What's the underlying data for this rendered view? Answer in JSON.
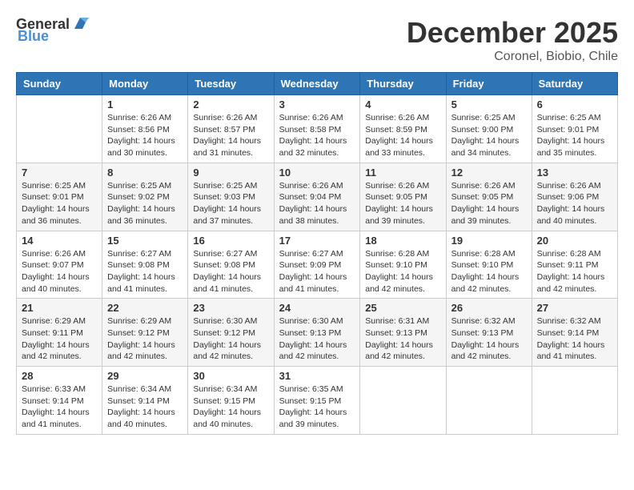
{
  "header": {
    "logo_general": "General",
    "logo_blue": "Blue",
    "month_year": "December 2025",
    "location": "Coronel, Biobio, Chile"
  },
  "weekdays": [
    "Sunday",
    "Monday",
    "Tuesday",
    "Wednesday",
    "Thursday",
    "Friday",
    "Saturday"
  ],
  "weeks": [
    [
      {
        "day": "",
        "sunrise": "",
        "sunset": "",
        "daylight": ""
      },
      {
        "day": "1",
        "sunrise": "Sunrise: 6:26 AM",
        "sunset": "Sunset: 8:56 PM",
        "daylight": "Daylight: 14 hours and 30 minutes."
      },
      {
        "day": "2",
        "sunrise": "Sunrise: 6:26 AM",
        "sunset": "Sunset: 8:57 PM",
        "daylight": "Daylight: 14 hours and 31 minutes."
      },
      {
        "day": "3",
        "sunrise": "Sunrise: 6:26 AM",
        "sunset": "Sunset: 8:58 PM",
        "daylight": "Daylight: 14 hours and 32 minutes."
      },
      {
        "day": "4",
        "sunrise": "Sunrise: 6:26 AM",
        "sunset": "Sunset: 8:59 PM",
        "daylight": "Daylight: 14 hours and 33 minutes."
      },
      {
        "day": "5",
        "sunrise": "Sunrise: 6:25 AM",
        "sunset": "Sunset: 9:00 PM",
        "daylight": "Daylight: 14 hours and 34 minutes."
      },
      {
        "day": "6",
        "sunrise": "Sunrise: 6:25 AM",
        "sunset": "Sunset: 9:01 PM",
        "daylight": "Daylight: 14 hours and 35 minutes."
      }
    ],
    [
      {
        "day": "7",
        "sunrise": "Sunrise: 6:25 AM",
        "sunset": "Sunset: 9:01 PM",
        "daylight": "Daylight: 14 hours and 36 minutes."
      },
      {
        "day": "8",
        "sunrise": "Sunrise: 6:25 AM",
        "sunset": "Sunset: 9:02 PM",
        "daylight": "Daylight: 14 hours and 36 minutes."
      },
      {
        "day": "9",
        "sunrise": "Sunrise: 6:25 AM",
        "sunset": "Sunset: 9:03 PM",
        "daylight": "Daylight: 14 hours and 37 minutes."
      },
      {
        "day": "10",
        "sunrise": "Sunrise: 6:26 AM",
        "sunset": "Sunset: 9:04 PM",
        "daylight": "Daylight: 14 hours and 38 minutes."
      },
      {
        "day": "11",
        "sunrise": "Sunrise: 6:26 AM",
        "sunset": "Sunset: 9:05 PM",
        "daylight": "Daylight: 14 hours and 39 minutes."
      },
      {
        "day": "12",
        "sunrise": "Sunrise: 6:26 AM",
        "sunset": "Sunset: 9:05 PM",
        "daylight": "Daylight: 14 hours and 39 minutes."
      },
      {
        "day": "13",
        "sunrise": "Sunrise: 6:26 AM",
        "sunset": "Sunset: 9:06 PM",
        "daylight": "Daylight: 14 hours and 40 minutes."
      }
    ],
    [
      {
        "day": "14",
        "sunrise": "Sunrise: 6:26 AM",
        "sunset": "Sunset: 9:07 PM",
        "daylight": "Daylight: 14 hours and 40 minutes."
      },
      {
        "day": "15",
        "sunrise": "Sunrise: 6:27 AM",
        "sunset": "Sunset: 9:08 PM",
        "daylight": "Daylight: 14 hours and 41 minutes."
      },
      {
        "day": "16",
        "sunrise": "Sunrise: 6:27 AM",
        "sunset": "Sunset: 9:08 PM",
        "daylight": "Daylight: 14 hours and 41 minutes."
      },
      {
        "day": "17",
        "sunrise": "Sunrise: 6:27 AM",
        "sunset": "Sunset: 9:09 PM",
        "daylight": "Daylight: 14 hours and 41 minutes."
      },
      {
        "day": "18",
        "sunrise": "Sunrise: 6:28 AM",
        "sunset": "Sunset: 9:10 PM",
        "daylight": "Daylight: 14 hours and 42 minutes."
      },
      {
        "day": "19",
        "sunrise": "Sunrise: 6:28 AM",
        "sunset": "Sunset: 9:10 PM",
        "daylight": "Daylight: 14 hours and 42 minutes."
      },
      {
        "day": "20",
        "sunrise": "Sunrise: 6:28 AM",
        "sunset": "Sunset: 9:11 PM",
        "daylight": "Daylight: 14 hours and 42 minutes."
      }
    ],
    [
      {
        "day": "21",
        "sunrise": "Sunrise: 6:29 AM",
        "sunset": "Sunset: 9:11 PM",
        "daylight": "Daylight: 14 hours and 42 minutes."
      },
      {
        "day": "22",
        "sunrise": "Sunrise: 6:29 AM",
        "sunset": "Sunset: 9:12 PM",
        "daylight": "Daylight: 14 hours and 42 minutes."
      },
      {
        "day": "23",
        "sunrise": "Sunrise: 6:30 AM",
        "sunset": "Sunset: 9:12 PM",
        "daylight": "Daylight: 14 hours and 42 minutes."
      },
      {
        "day": "24",
        "sunrise": "Sunrise: 6:30 AM",
        "sunset": "Sunset: 9:13 PM",
        "daylight": "Daylight: 14 hours and 42 minutes."
      },
      {
        "day": "25",
        "sunrise": "Sunrise: 6:31 AM",
        "sunset": "Sunset: 9:13 PM",
        "daylight": "Daylight: 14 hours and 42 minutes."
      },
      {
        "day": "26",
        "sunrise": "Sunrise: 6:32 AM",
        "sunset": "Sunset: 9:13 PM",
        "daylight": "Daylight: 14 hours and 42 minutes."
      },
      {
        "day": "27",
        "sunrise": "Sunrise: 6:32 AM",
        "sunset": "Sunset: 9:14 PM",
        "daylight": "Daylight: 14 hours and 41 minutes."
      }
    ],
    [
      {
        "day": "28",
        "sunrise": "Sunrise: 6:33 AM",
        "sunset": "Sunset: 9:14 PM",
        "daylight": "Daylight: 14 hours and 41 minutes."
      },
      {
        "day": "29",
        "sunrise": "Sunrise: 6:34 AM",
        "sunset": "Sunset: 9:14 PM",
        "daylight": "Daylight: 14 hours and 40 minutes."
      },
      {
        "day": "30",
        "sunrise": "Sunrise: 6:34 AM",
        "sunset": "Sunset: 9:15 PM",
        "daylight": "Daylight: 14 hours and 40 minutes."
      },
      {
        "day": "31",
        "sunrise": "Sunrise: 6:35 AM",
        "sunset": "Sunset: 9:15 PM",
        "daylight": "Daylight: 14 hours and 39 minutes."
      },
      {
        "day": "",
        "sunrise": "",
        "sunset": "",
        "daylight": ""
      },
      {
        "day": "",
        "sunrise": "",
        "sunset": "",
        "daylight": ""
      },
      {
        "day": "",
        "sunrise": "",
        "sunset": "",
        "daylight": ""
      }
    ]
  ]
}
